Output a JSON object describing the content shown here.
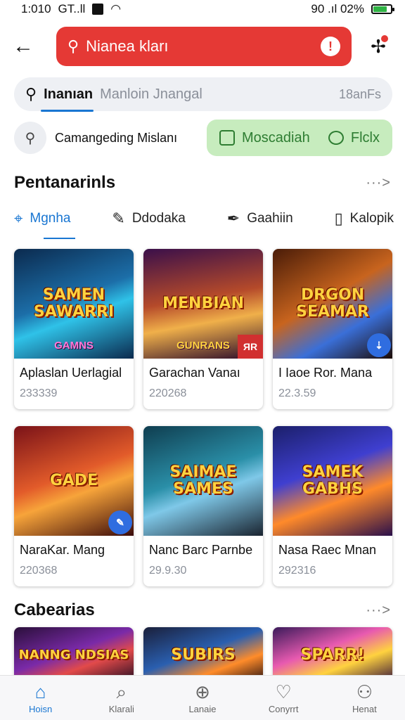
{
  "status_bar": {
    "time": "1:010",
    "carrier": "GT..ll",
    "right_text": "90 .ıl 02%",
    "battery_level": 0.8
  },
  "top_bar": {
    "search_text": "Nianea kları"
  },
  "search": {
    "tab": "Inanıan",
    "value": "Manloin Jnangal",
    "count": "18anFs"
  },
  "filter": {
    "label": "Camangeding Mislanı",
    "chip_left": "Moscadiah",
    "chip_right": "Flclx"
  },
  "section1": {
    "title": "Pentanarinls",
    "more": "···>"
  },
  "categories": [
    {
      "label": "Mgnha",
      "icon": "pin-icon"
    },
    {
      "label": "Ddodaka",
      "icon": "pencil-icon"
    },
    {
      "label": "Gaahiin",
      "icon": "pen-icon"
    },
    {
      "label": "Kalopik",
      "icon": "bookmark-icon"
    }
  ],
  "cards_row1": [
    {
      "art_title": "SAMEN SAWARRI",
      "art_sub": "GAMNS",
      "name": "Aplaslan Uerlagial",
      "num": "233339",
      "badge": ""
    },
    {
      "art_title": "MENBIAN",
      "art_sub": "GUNRANS",
      "name": "Garachan Vanaı",
      "num": "220268",
      "badge": "ЯR"
    },
    {
      "art_title": "DRGON SEAMAR",
      "art_sub": "",
      "name": "I Iaoe Ror. Mana",
      "num": "22.3.59",
      "badge": "⇣"
    }
  ],
  "cards_row2": [
    {
      "art_title": "GADE",
      "art_sub": "",
      "name": "NaraKar. Mang",
      "num": "220368",
      "badge": "✎"
    },
    {
      "art_title": "SAIMAE SAMES",
      "art_sub": "",
      "name": "Nanc Barc Parnbe",
      "num": "29.9.30",
      "badge": ""
    },
    {
      "art_title": "SAMEK GABHS",
      "art_sub": "",
      "name": "Nasa Raec Mnan",
      "num": "292316",
      "badge": ""
    }
  ],
  "section2": {
    "title": "Cabearias",
    "more": "···>"
  },
  "cards_row3": [
    {
      "art_title": "NANNG NDSIAS"
    },
    {
      "art_title": "SUBIRS"
    },
    {
      "art_title": "SPARR!"
    }
  ],
  "nav": [
    {
      "label": "Hoisn",
      "icon": "home-icon",
      "glyph": "⌂"
    },
    {
      "label": "Klarali",
      "icon": "search-icon",
      "glyph": "⌕"
    },
    {
      "label": "Lanaie",
      "icon": "add-circle-icon",
      "glyph": "⊕"
    },
    {
      "label": "Conyrrt",
      "icon": "heart-icon",
      "glyph": "♡"
    },
    {
      "label": "Henat",
      "icon": "profile-icon",
      "glyph": "⚇"
    }
  ],
  "colors": {
    "accent": "#1976d2",
    "red": "#e53935",
    "green_chip": "#c7ecbe"
  }
}
